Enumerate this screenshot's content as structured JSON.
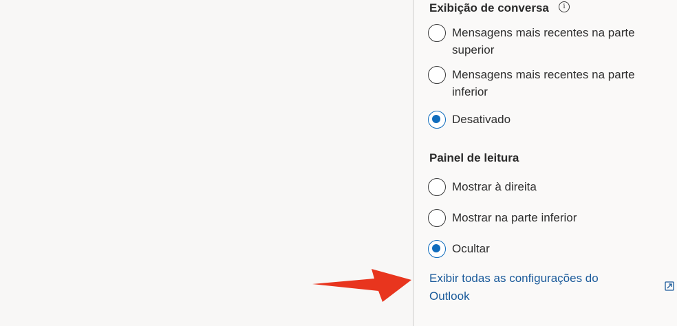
{
  "conversation_view": {
    "title": "Exibição de conversa",
    "info_icon": "info-icon",
    "options": [
      {
        "label": "Mensagens mais recentes na parte superior",
        "checked": false
      },
      {
        "label": "Mensagens mais recentes na parte inferior",
        "checked": false
      },
      {
        "label": "Desativado",
        "checked": true
      }
    ]
  },
  "reading_pane": {
    "title": "Painel de leitura",
    "options": [
      {
        "label": "Mostrar à direita",
        "checked": false
      },
      {
        "label": "Mostrar na parte inferior",
        "checked": false
      },
      {
        "label": "Ocultar",
        "checked": true
      }
    ]
  },
  "footer": {
    "all_settings_link": "Exibir todas as configurações do Outlook",
    "expand_icon": "open-in-new-window-icon"
  },
  "annotation": {
    "arrow_color": "#e8351e",
    "arrow_icon": "red-arrow-annotation"
  },
  "colors": {
    "accent": "#0f6cbd",
    "link": "#1a5a9a"
  }
}
